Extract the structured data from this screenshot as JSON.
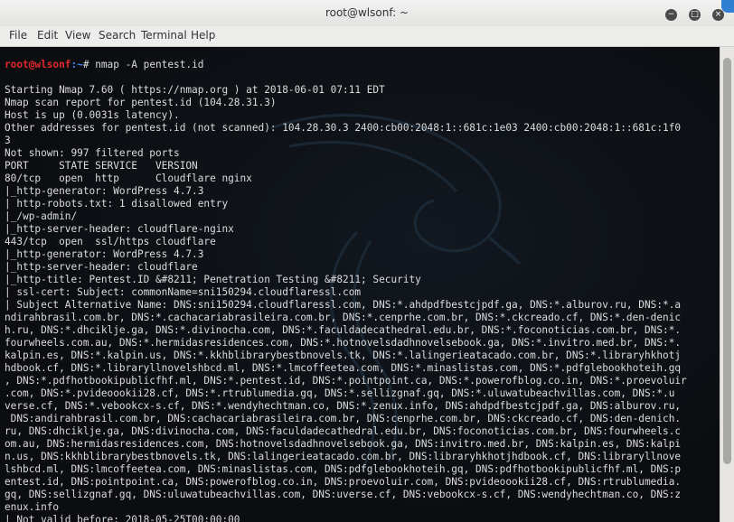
{
  "window": {
    "title": "root@wlsonf: ~",
    "buttons": {
      "minimize": "−",
      "maximize": "□",
      "close": "×"
    }
  },
  "menubar": {
    "items": [
      "File",
      "Edit",
      "View",
      "Search",
      "Terminal",
      "Help"
    ]
  },
  "terminal": {
    "prompt_user": "root@wlsonf",
    "prompt_path": ":~",
    "prompt_symbol": "# ",
    "command": "nmap -A pentest.id",
    "lines": [
      "Starting Nmap 7.60 ( https://nmap.org ) at 2018-06-01 07:11 EDT",
      "Nmap scan report for pentest.id (104.28.31.3)",
      "Host is up (0.0031s latency).",
      "Other addresses for pentest.id (not scanned): 104.28.30.3 2400:cb00:2048:1::681c:1e03 2400:cb00:2048:1::681c:1f0",
      "3",
      "Not shown: 997 filtered ports",
      "PORT     STATE SERVICE   VERSION",
      "80/tcp   open  http      Cloudflare nginx",
      "|_http-generator: WordPress 4.7.3",
      "| http-robots.txt: 1 disallowed entry",
      "|_/wp-admin/",
      "|_http-server-header: cloudflare-nginx",
      "443/tcp  open  ssl/https cloudflare",
      "|_http-generator: WordPress 4.7.3",
      "|_http-server-header: cloudflare",
      "|_http-title: Pentest.ID &#8211; Penetration Testing &#8211; Security",
      "| ssl-cert: Subject: commonName=sni150294.cloudflaressl.com",
      "| Subject Alternative Name: DNS:sni150294.cloudflaressl.com, DNS:*.ahdpdfbestcjpdf.ga, DNS:*.alburov.ru, DNS:*.a",
      "ndirahbrasil.com.br, DNS:*.cachacariabrasileira.com.br, DNS:*.cenprhe.com.br, DNS:*.ckcreado.cf, DNS:*.den-denic",
      "h.ru, DNS:*.dhciklje.ga, DNS:*.divinocha.com, DNS:*.faculdadecathedral.edu.br, DNS:*.foconoticias.com.br, DNS:*.",
      "fourwheels.com.au, DNS:*.hermidasresidences.com, DNS:*.hotnovelsdadhnovelsebook.ga, DNS:*.invitro.med.br, DNS:*.",
      "kalpin.es, DNS:*.kalpin.us, DNS:*.kkhblibrarybestbnovels.tk, DNS:*.lalingerieatacado.com.br, DNS:*.libraryhkhotj",
      "hdbook.cf, DNS:*.libraryllnovelshbcd.ml, DNS:*.lmcoffeetea.com, DNS:*.minaslistas.com, DNS:*.pdfglebookhoteih.gq",
      ", DNS:*.pdfhotbookipublicfhf.ml, DNS:*.pentest.id, DNS:*.pointpoint.ca, DNS:*.powerofblog.co.in, DNS:*.proevoluir",
      ".com, DNS:*.pvideoookii28.cf, DNS:*.rtrublumedia.gq, DNS:*.sellizgnaf.gq, DNS:*.uluwatubeachvillas.com, DNS:*.u",
      "verse.cf, DNS:*.vebookcx-s.cf, DNS:*.wendyhechtman.co, DNS:*.zenux.info, DNS:ahdpdfbestcjpdf.ga, DNS:alburov.ru,",
      " DNS:andirahbrasil.com.br, DNS:cachacariabrasileira.com.br, DNS:cenprhe.com.br, DNS:ckcreado.cf, DNS:den-denich.",
      "ru, DNS:dhciklje.ga, DNS:divinocha.com, DNS:faculdadecathedral.edu.br, DNS:foconoticias.com.br, DNS:fourwheels.c",
      "om.au, DNS:hermidasresidences.com, DNS:hotnovelsdadhnovelsebook.ga, DNS:invitro.med.br, DNS:kalpin.es, DNS:kalpi",
      "n.us, DNS:kkhblibrarybestbnovels.tk, DNS:lalingerieatacado.com.br, DNS:libraryhkhotjhdbook.cf, DNS:libraryllnove",
      "lshbcd.ml, DNS:lmcoffeetea.com, DNS:minaslistas.com, DNS:pdfglebookhoteih.gq, DNS:pdfhotbookipublicfhf.ml, DNS:p",
      "entest.id, DNS:pointpoint.ca, DNS:powerofblog.co.in, DNS:proevoluir.com, DNS:pvideoookii28.cf, DNS:rtrublumedia.",
      "gq, DNS:sellizgnaf.gq, DNS:uluwatubeachvillas.com, DNS:uverse.cf, DNS:vebookcx-s.cf, DNS:wendyhechtman.co, DNS:z",
      "enux.info",
      "| Not valid before: 2018-05-25T00:00:00"
    ]
  },
  "colors": {
    "prompt_user": "#e0282a",
    "prompt_path": "#3b82f6",
    "terminal_bg": "#0d0f12",
    "terminal_text": "#dcdcdc"
  }
}
